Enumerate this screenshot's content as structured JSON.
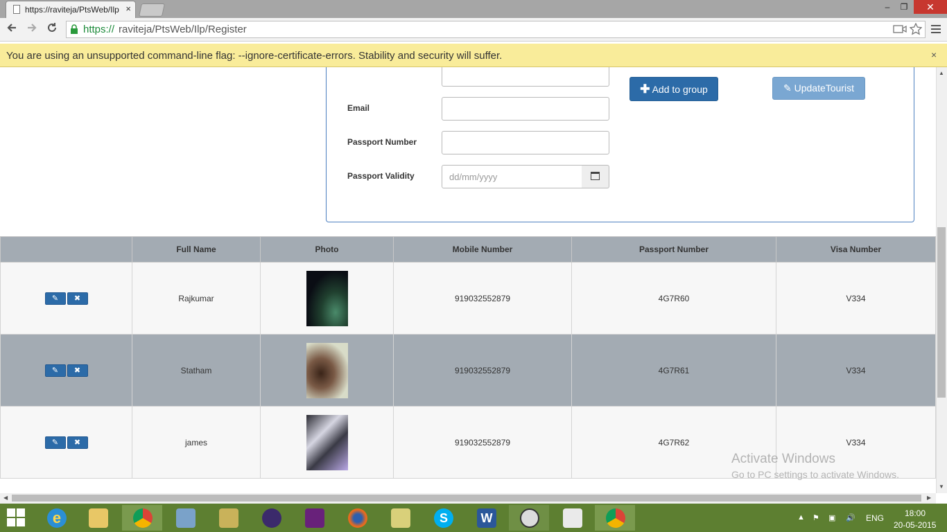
{
  "browser": {
    "tab_title": "https://raviteja/PtsWeb/Ilp",
    "tab_close": "×",
    "url_scheme": "https://",
    "url_rest": "raviteja/PtsWeb/Ilp/Register",
    "window_controls": {
      "minimize": "–",
      "restore": "❐",
      "close": "✕"
    }
  },
  "infobar": {
    "message": "You are using an unsupported command-line flag: --ignore-certificate-errors. Stability and security will suffer.",
    "close": "×"
  },
  "form": {
    "email_label": "Email",
    "passport_number_label": "Passport Number",
    "passport_validity_label": "Passport Validity",
    "date_placeholder": "dd/mm/yyyy",
    "add_button": "Add to group",
    "update_button": "UpdateTourist"
  },
  "table": {
    "headers": [
      "",
      "Full Name",
      "Photo",
      "Mobile Number",
      "Passport Number",
      "Visa Number"
    ],
    "rows": [
      {
        "name": "Rajkumar",
        "mobile": "919032552879",
        "passport": "4G7R60",
        "visa": "V334"
      },
      {
        "name": "Statham",
        "mobile": "919032552879",
        "passport": "4G7R61",
        "visa": "V334"
      },
      {
        "name": "james",
        "mobile": "919032552879",
        "passport": "4G7R62",
        "visa": "V334"
      }
    ]
  },
  "watermark": {
    "line1": "Activate Windows",
    "line2": "Go to PC settings to activate Windows."
  },
  "taskbar": {
    "apps": [
      "internet-explorer",
      "file-explorer",
      "chrome",
      "server-manager",
      "tools",
      "eclipse",
      "visual-studio",
      "firefox",
      "folder",
      "skype",
      "word",
      "pts",
      "reader",
      "chrome"
    ],
    "language": "ENG",
    "time": "18:00",
    "date": "20-05-2015"
  },
  "colors": {
    "accent": "#2c6ba8",
    "table_header": "#a3abb3",
    "infobar": "#f9ec9a",
    "taskbar": "#5d7f31",
    "secure_green": "#1c8a3a"
  }
}
